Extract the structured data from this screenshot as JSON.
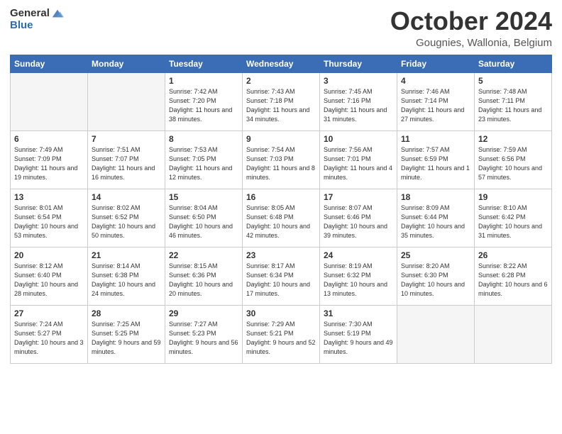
{
  "header": {
    "logo_general": "General",
    "logo_blue": "Blue",
    "month": "October 2024",
    "location": "Gougnies, Wallonia, Belgium"
  },
  "weekdays": [
    "Sunday",
    "Monday",
    "Tuesday",
    "Wednesday",
    "Thursday",
    "Friday",
    "Saturday"
  ],
  "weeks": [
    [
      {
        "day": "",
        "info": ""
      },
      {
        "day": "",
        "info": ""
      },
      {
        "day": "1",
        "info": "Sunrise: 7:42 AM\nSunset: 7:20 PM\nDaylight: 11 hours and 38 minutes."
      },
      {
        "day": "2",
        "info": "Sunrise: 7:43 AM\nSunset: 7:18 PM\nDaylight: 11 hours and 34 minutes."
      },
      {
        "day": "3",
        "info": "Sunrise: 7:45 AM\nSunset: 7:16 PM\nDaylight: 11 hours and 31 minutes."
      },
      {
        "day": "4",
        "info": "Sunrise: 7:46 AM\nSunset: 7:14 PM\nDaylight: 11 hours and 27 minutes."
      },
      {
        "day": "5",
        "info": "Sunrise: 7:48 AM\nSunset: 7:11 PM\nDaylight: 11 hours and 23 minutes."
      }
    ],
    [
      {
        "day": "6",
        "info": "Sunrise: 7:49 AM\nSunset: 7:09 PM\nDaylight: 11 hours and 19 minutes."
      },
      {
        "day": "7",
        "info": "Sunrise: 7:51 AM\nSunset: 7:07 PM\nDaylight: 11 hours and 16 minutes."
      },
      {
        "day": "8",
        "info": "Sunrise: 7:53 AM\nSunset: 7:05 PM\nDaylight: 11 hours and 12 minutes."
      },
      {
        "day": "9",
        "info": "Sunrise: 7:54 AM\nSunset: 7:03 PM\nDaylight: 11 hours and 8 minutes."
      },
      {
        "day": "10",
        "info": "Sunrise: 7:56 AM\nSunset: 7:01 PM\nDaylight: 11 hours and 4 minutes."
      },
      {
        "day": "11",
        "info": "Sunrise: 7:57 AM\nSunset: 6:59 PM\nDaylight: 11 hours and 1 minute."
      },
      {
        "day": "12",
        "info": "Sunrise: 7:59 AM\nSunset: 6:56 PM\nDaylight: 10 hours and 57 minutes."
      }
    ],
    [
      {
        "day": "13",
        "info": "Sunrise: 8:01 AM\nSunset: 6:54 PM\nDaylight: 10 hours and 53 minutes."
      },
      {
        "day": "14",
        "info": "Sunrise: 8:02 AM\nSunset: 6:52 PM\nDaylight: 10 hours and 50 minutes."
      },
      {
        "day": "15",
        "info": "Sunrise: 8:04 AM\nSunset: 6:50 PM\nDaylight: 10 hours and 46 minutes."
      },
      {
        "day": "16",
        "info": "Sunrise: 8:05 AM\nSunset: 6:48 PM\nDaylight: 10 hours and 42 minutes."
      },
      {
        "day": "17",
        "info": "Sunrise: 8:07 AM\nSunset: 6:46 PM\nDaylight: 10 hours and 39 minutes."
      },
      {
        "day": "18",
        "info": "Sunrise: 8:09 AM\nSunset: 6:44 PM\nDaylight: 10 hours and 35 minutes."
      },
      {
        "day": "19",
        "info": "Sunrise: 8:10 AM\nSunset: 6:42 PM\nDaylight: 10 hours and 31 minutes."
      }
    ],
    [
      {
        "day": "20",
        "info": "Sunrise: 8:12 AM\nSunset: 6:40 PM\nDaylight: 10 hours and 28 minutes."
      },
      {
        "day": "21",
        "info": "Sunrise: 8:14 AM\nSunset: 6:38 PM\nDaylight: 10 hours and 24 minutes."
      },
      {
        "day": "22",
        "info": "Sunrise: 8:15 AM\nSunset: 6:36 PM\nDaylight: 10 hours and 20 minutes."
      },
      {
        "day": "23",
        "info": "Sunrise: 8:17 AM\nSunset: 6:34 PM\nDaylight: 10 hours and 17 minutes."
      },
      {
        "day": "24",
        "info": "Sunrise: 8:19 AM\nSunset: 6:32 PM\nDaylight: 10 hours and 13 minutes."
      },
      {
        "day": "25",
        "info": "Sunrise: 8:20 AM\nSunset: 6:30 PM\nDaylight: 10 hours and 10 minutes."
      },
      {
        "day": "26",
        "info": "Sunrise: 8:22 AM\nSunset: 6:28 PM\nDaylight: 10 hours and 6 minutes."
      }
    ],
    [
      {
        "day": "27",
        "info": "Sunrise: 7:24 AM\nSunset: 5:27 PM\nDaylight: 10 hours and 3 minutes."
      },
      {
        "day": "28",
        "info": "Sunrise: 7:25 AM\nSunset: 5:25 PM\nDaylight: 9 hours and 59 minutes."
      },
      {
        "day": "29",
        "info": "Sunrise: 7:27 AM\nSunset: 5:23 PM\nDaylight: 9 hours and 56 minutes."
      },
      {
        "day": "30",
        "info": "Sunrise: 7:29 AM\nSunset: 5:21 PM\nDaylight: 9 hours and 52 minutes."
      },
      {
        "day": "31",
        "info": "Sunrise: 7:30 AM\nSunset: 5:19 PM\nDaylight: 9 hours and 49 minutes."
      },
      {
        "day": "",
        "info": ""
      },
      {
        "day": "",
        "info": ""
      }
    ]
  ]
}
